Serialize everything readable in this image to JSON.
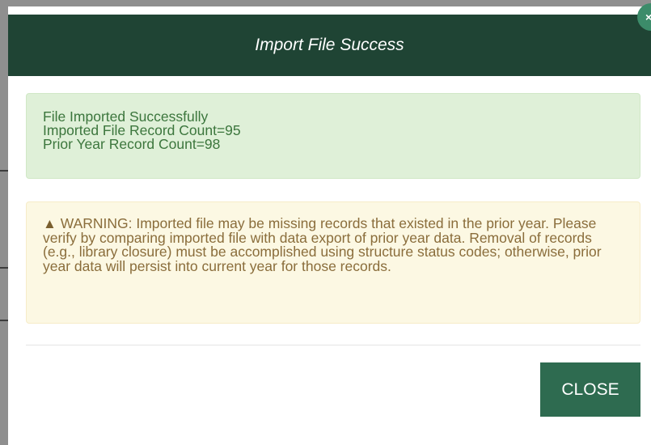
{
  "modal": {
    "title": "Import File Success",
    "close_icon_glyph": "×",
    "success_lines": [
      "File Imported Successfully",
      "Imported File Record Count=95",
      "Prior Year Record Count=98"
    ],
    "warning_icon": "warning-triangle-icon",
    "warning_icon_glyph": "▲",
    "warning_text": "WARNING: Imported file may be missing records that existed in the prior year. Please verify by comparing imported file with data export of prior year data. Removal of records (e.g., library closure) must be accomplished using structure status codes; otherwise, prior year data will persist into current year for those records.",
    "close_button_label": "CLOSE"
  },
  "colors": {
    "header_bg": "#1f4434",
    "button_bg": "#2e6b50",
    "success_bg": "#dff0d8",
    "success_text": "#3c763d",
    "warning_bg": "#fcf8e3",
    "warning_text": "#8a6d3b"
  }
}
